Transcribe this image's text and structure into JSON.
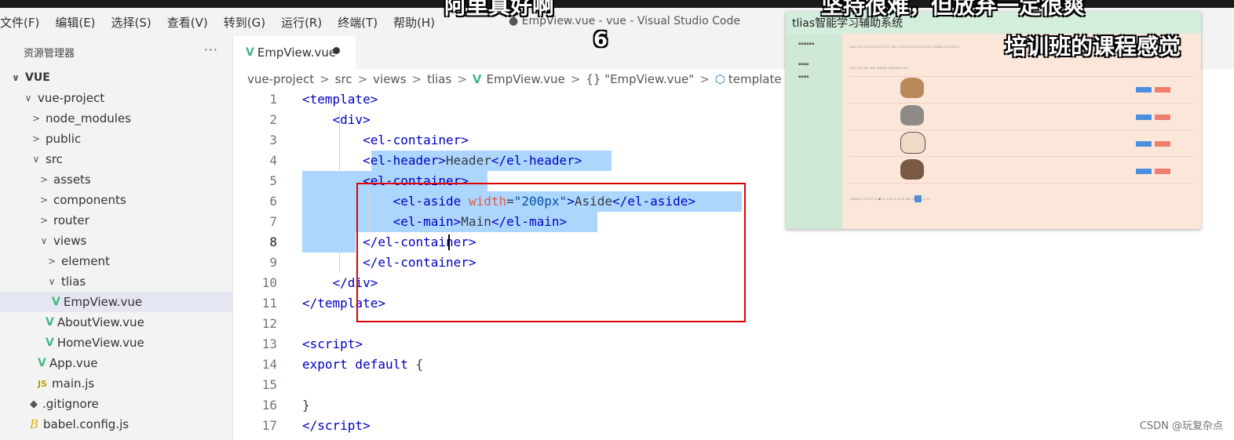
{
  "menu": [
    "文件(F)",
    "编辑(E)",
    "选择(S)",
    "查看(V)",
    "转到(G)",
    "运行(R)",
    "终端(T)",
    "帮助(H)"
  ],
  "window_title": "● EmpView.vue - vue - Visual Studio Code",
  "sidebar": {
    "title": "资源管理器",
    "more": "···",
    "tree": [
      {
        "label": "VUE",
        "chev": "∨",
        "indent": 12,
        "bold": true
      },
      {
        "label": "vue-project",
        "chev": "∨",
        "indent": 28
      },
      {
        "label": "node_modules",
        "chev": ">",
        "indent": 38
      },
      {
        "label": "public",
        "chev": ">",
        "indent": 38
      },
      {
        "label": "src",
        "chev": "∨",
        "indent": 38
      },
      {
        "label": "assets",
        "chev": ">",
        "indent": 48
      },
      {
        "label": "components",
        "chev": ">",
        "indent": 48
      },
      {
        "label": "router",
        "chev": ">",
        "indent": 48
      },
      {
        "label": "views",
        "chev": "∨",
        "indent": 48
      },
      {
        "label": "element",
        "chev": ">",
        "indent": 58
      },
      {
        "label": "tlias",
        "chev": "∨",
        "indent": 58
      },
      {
        "label": "EmpView.vue",
        "icon": "vue",
        "indent": 66,
        "selected": true
      },
      {
        "label": "AboutView.vue",
        "icon": "vue",
        "indent": 58
      },
      {
        "label": "HomeView.vue",
        "icon": "vue",
        "indent": 58
      },
      {
        "label": "App.vue",
        "icon": "vue",
        "indent": 48
      },
      {
        "label": "main.js",
        "icon": "js",
        "indent": 48
      },
      {
        "label": ".gitignore",
        "icon": "git",
        "indent": 38
      },
      {
        "label": "babel.config.js",
        "icon": "babel",
        "indent": 38
      }
    ]
  },
  "tab": {
    "label": "EmpView.vue"
  },
  "breadcrumb": [
    "vue-project",
    "src",
    "views",
    "tlias",
    "EmpView.vue",
    "{} \"EmpView.vue\"",
    "template",
    "div"
  ],
  "code_lines": [
    {
      "n": "1",
      "html": "<span class=\"kw\">&lt;template&gt;</span>"
    },
    {
      "n": "2",
      "html": "    <span class=\"kw\">&lt;div&gt;</span>"
    },
    {
      "n": "3",
      "html": "        <span class=\"kw\">&lt;el-container&gt;</span>"
    },
    {
      "n": "4",
      "html": "        <span class=\"kw\">&lt;el-header&gt;</span>Header<span class=\"kw\">&lt;/el-header&gt;</span>"
    },
    {
      "n": "5",
      "html": "        <span class=\"kw\">&lt;el-container&gt;</span>"
    },
    {
      "n": "6",
      "html": "            <span class=\"kw\">&lt;el-aside</span> <span class=\"attr\">width</span>=<span class=\"str\">\"200px\"</span><span class=\"kw\">&gt;</span>Aside<span class=\"kw\">&lt;/el-aside&gt;</span>"
    },
    {
      "n": "7",
      "html": "            <span class=\"kw\">&lt;el-main&gt;</span>Main<span class=\"kw\">&lt;/el-main&gt;</span>"
    },
    {
      "n": "8",
      "html": "        <span class=\"kw\">&lt;/el-container&gt;</span>"
    },
    {
      "n": "9",
      "html": "        <span class=\"kw\">&lt;/el-container&gt;</span>"
    },
    {
      "n": "10",
      "html": "    <span class=\"kw\">&lt;/div&gt;</span>"
    },
    {
      "n": "11",
      "html": "<span class=\"kw\">&lt;/template&gt;</span>"
    },
    {
      "n": "12",
      "html": ""
    },
    {
      "n": "13",
      "html": "<span class=\"kw\">&lt;script&gt;</span>"
    },
    {
      "n": "14",
      "html": "<span class=\"kw\">export default</span> {"
    },
    {
      "n": "15",
      "html": ""
    },
    {
      "n": "16",
      "html": "}"
    },
    {
      "n": "17",
      "html": "<span class=\"kw\">&lt;/script&gt;</span>"
    }
  ],
  "active_line": 8,
  "preview": {
    "title": "tlias智能学习辅助系统"
  },
  "captions": {
    "top_left": "阿里真好啊",
    "top_left_num": "6",
    "top_right": "坚持很难，但放弃一定很爽",
    "right": "培训班的课程感觉"
  },
  "watermark": "CSDN @玩复杂点"
}
